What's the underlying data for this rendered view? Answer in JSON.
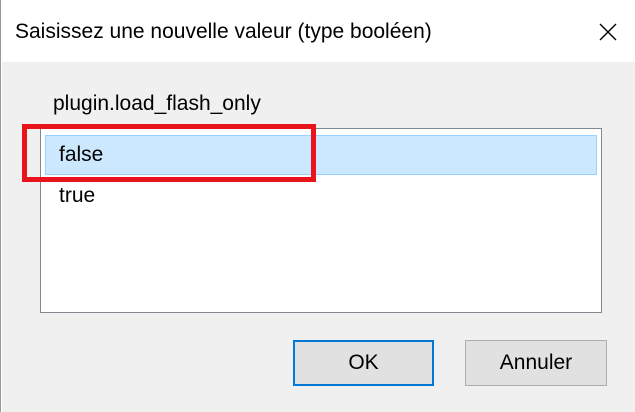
{
  "dialog": {
    "title": "Saisissez une nouvelle valeur (type booléen)",
    "close_icon": "close-icon"
  },
  "field": {
    "label": "plugin.load_flash_only"
  },
  "options": {
    "items": [
      {
        "label": "false",
        "selected": true
      },
      {
        "label": "true",
        "selected": false
      }
    ]
  },
  "buttons": {
    "ok_label": "OK",
    "cancel_label": "Annuler"
  },
  "colors": {
    "selection_bg": "#cce8ff",
    "selection_border": "#99d1ff",
    "highlight_annotation": "#e8141b",
    "default_button_border": "#0078d7"
  }
}
